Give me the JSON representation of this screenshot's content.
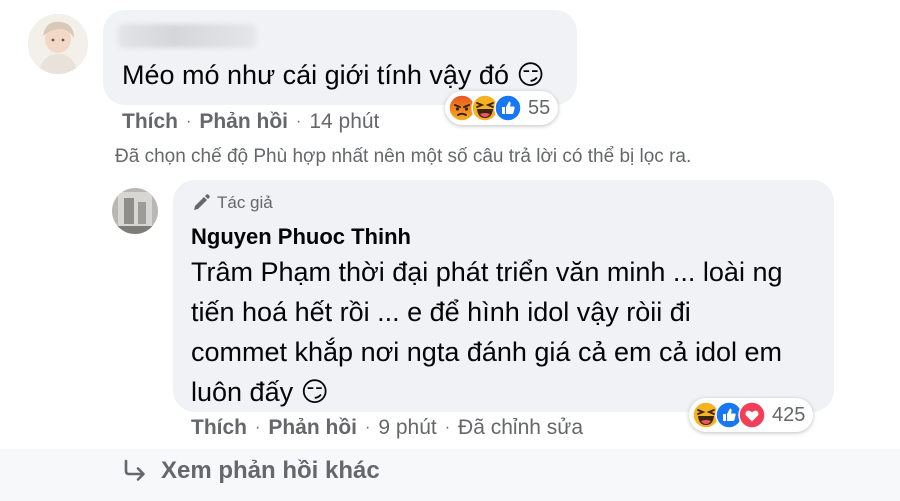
{
  "comment1": {
    "author_hidden": "",
    "text": "Méo mó như cái giới tính vậy đó 😏",
    "actions": {
      "like": "Thích",
      "reply": "Phản hồi",
      "time": "14 phút"
    },
    "reactions": {
      "icons": [
        "angry-reaction-icon",
        "haha-reaction-icon",
        "like-reaction-icon"
      ],
      "count": "55"
    }
  },
  "filter_notice": "Đã chọn chế độ Phù hợp nhất nên một số câu trả lời có thể bị lọc ra.",
  "reply1": {
    "badge": "Tác giả",
    "author": "Nguyen Phuoc Thinh",
    "lines": [
      "Trâm Phạm thời đại phát triển văn minh ... loài ng",
      "tiến hoá hết rồi ... e để hình idol vậy ròii đi",
      "commet khắp nơi ngta đánh giá cả em cả idol em",
      "luôn đấy 😏"
    ],
    "actions": {
      "like": "Thích",
      "reply": "Phản hồi",
      "time": "9 phút",
      "edited": "Đã chỉnh sửa"
    },
    "reactions": {
      "icons": [
        "haha-reaction-icon",
        "like-reaction-icon",
        "love-reaction-icon"
      ],
      "count": "425"
    }
  },
  "more_replies": "Xem phản hồi khác",
  "colors": {
    "bubble": "#f0f2f5",
    "secondary_text": "#65676b",
    "like_blue": "#1877f2",
    "love_red": "#f33e58",
    "emoji_yellow": "#f7b125"
  }
}
